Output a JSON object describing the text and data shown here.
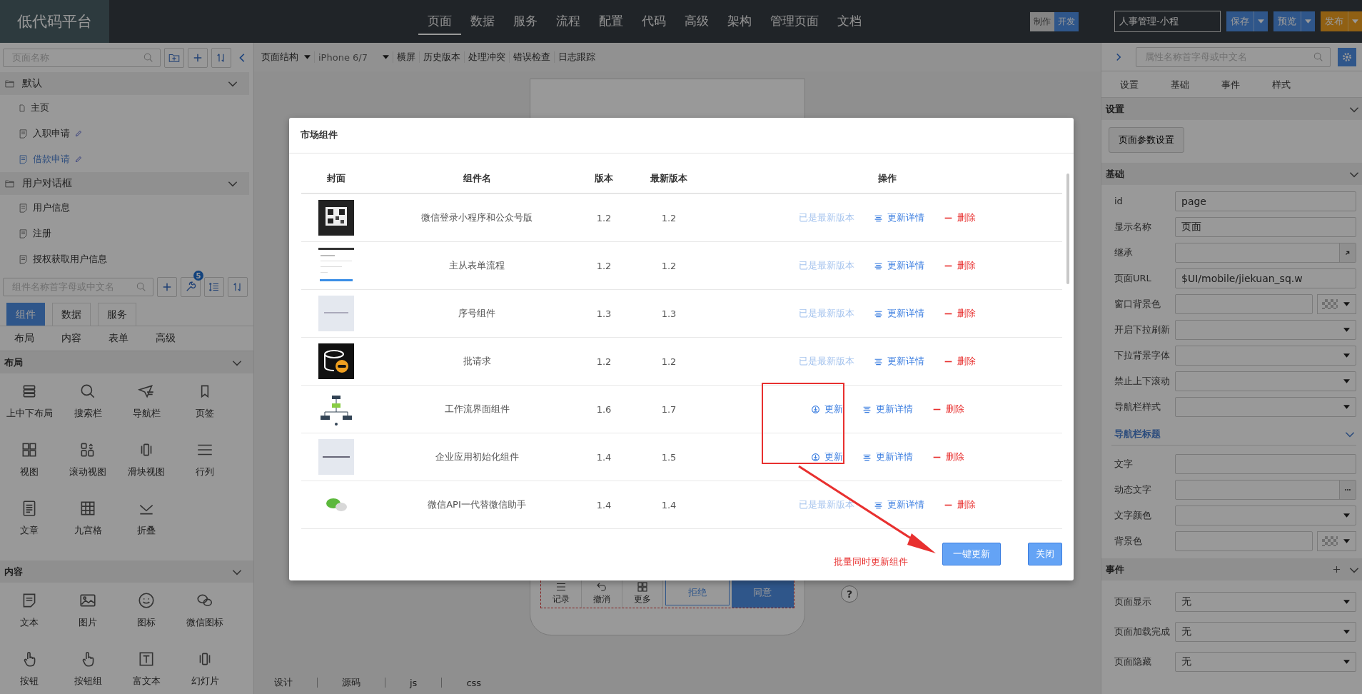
{
  "topbar": {
    "logo": "低代码平台",
    "nav": [
      {
        "label": "页面",
        "selected": true
      },
      {
        "label": "数据",
        "selected": false
      },
      {
        "label": "服务",
        "selected": false
      },
      {
        "label": "流程",
        "selected": false
      },
      {
        "label": "配置",
        "selected": false
      },
      {
        "label": "代码",
        "selected": false
      },
      {
        "label": "高级",
        "selected": false
      },
      {
        "label": "架构",
        "selected": false
      },
      {
        "label": "管理页面",
        "selected": false
      },
      {
        "label": "文档",
        "selected": false
      }
    ],
    "mode_toggle": [
      {
        "label": "制作",
        "selected": false
      },
      {
        "label": "开发",
        "selected": true
      }
    ],
    "project_select": "人事管理-小程",
    "actions": [
      {
        "label": "保存",
        "kind": "primary"
      },
      {
        "label": "预览",
        "kind": "primary"
      },
      {
        "label": "发布",
        "kind": "warning"
      }
    ]
  },
  "left_panel": {
    "page_search": {
      "placeholder": "页面名称"
    },
    "page_tree": [
      {
        "label": "默认",
        "expanded": true,
        "children": [
          {
            "label": "主页",
            "kind": "home",
            "selected": false,
            "editable": false
          },
          {
            "label": "入职申请",
            "kind": "page",
            "selected": false,
            "editable": true
          },
          {
            "label": "借款申请",
            "kind": "page",
            "selected": true,
            "editable": true
          }
        ]
      },
      {
        "label": "用户对话框",
        "expanded": true,
        "children": [
          {
            "label": "用户信息",
            "kind": "page",
            "selected": false,
            "editable": false
          },
          {
            "label": "注册",
            "kind": "page",
            "selected": false,
            "editable": false
          },
          {
            "label": "授权获取用户信息",
            "kind": "page",
            "selected": false,
            "editable": false
          }
        ]
      }
    ],
    "component_search": {
      "placeholder": "组件名称首字母或中文名"
    },
    "update_badge": "5",
    "tabs": [
      {
        "label": "组件",
        "selected": true
      },
      {
        "label": "数据",
        "selected": false
      },
      {
        "label": "服务",
        "selected": false
      }
    ],
    "categories": [
      "布局",
      "内容",
      "表单",
      "高级"
    ],
    "sections": [
      {
        "title": "布局",
        "expanded": true,
        "items": [
          "上中下布局",
          "搜索栏",
          "导航栏",
          "页签",
          "视图",
          "滚动视图",
          "滑块视图",
          "行列",
          "文章",
          "九宫格",
          "折叠"
        ]
      },
      {
        "title": "内容",
        "expanded": true,
        "items": [
          "文本",
          "图片",
          "图标",
          "微信图标",
          "按钮",
          "按钮组",
          "富文本",
          "幻灯片"
        ]
      }
    ]
  },
  "canvas": {
    "toolbar": {
      "structure_menu": "页面结构",
      "device": "iPhone 6/7",
      "links": [
        "横屏",
        "历史版本",
        "处理冲突",
        "错误检查",
        "日志跟踪"
      ]
    },
    "phone_bar": [
      {
        "label": "记录",
        "kind": "tool"
      },
      {
        "label": "撤消",
        "kind": "tool"
      },
      {
        "label": "更多",
        "kind": "tool"
      },
      {
        "label": "拒绝",
        "kind": "reject"
      },
      {
        "label": "同意",
        "kind": "accept"
      }
    ],
    "help": "?",
    "bottom_tabs": [
      "设计",
      "源码",
      "js",
      "css"
    ]
  },
  "right_panel": {
    "search": {
      "placeholder": "属性名称首字母或中文名"
    },
    "tabs": [
      "设置",
      "基础",
      "事件",
      "样式"
    ],
    "sections": [
      {
        "title": "设置",
        "expanded": true,
        "buttons": [
          "页面参数设置"
        ]
      },
      {
        "title": "基础",
        "expanded": true,
        "fields": [
          {
            "label": "id",
            "kind": "text",
            "value": "page"
          },
          {
            "label": "显示名称",
            "kind": "text",
            "value": "页面"
          },
          {
            "label": "继承",
            "kind": "link"
          },
          {
            "label": "页面URL",
            "kind": "text",
            "value": "$UI/mobile/jiekuan_sq.w"
          },
          {
            "label": "窗口背景色",
            "kind": "color"
          },
          {
            "label": "开启下拉刷新",
            "kind": "select"
          },
          {
            "label": "下拉背景字体",
            "kind": "select"
          },
          {
            "label": "禁止上下滚动",
            "kind": "select"
          },
          {
            "label": "导航栏样式",
            "kind": "select"
          },
          {
            "label": "导航栏标题",
            "kind": "subheading"
          },
          {
            "label": "文字",
            "kind": "text"
          },
          {
            "label": "动态文字",
            "kind": "dots"
          },
          {
            "label": "文字颜色",
            "kind": "select"
          },
          {
            "label": "背景色",
            "kind": "color"
          }
        ]
      },
      {
        "title": "事件",
        "expanded": true,
        "fields": [
          {
            "label": "页面显示",
            "kind": "select",
            "value": "无"
          },
          {
            "label": "页面加载完成",
            "kind": "select",
            "value": "无"
          },
          {
            "label": "页面隐藏",
            "kind": "select",
            "value": "无"
          }
        ]
      }
    ]
  },
  "dialog": {
    "title": "市场组件",
    "columns": [
      "封面",
      "组件名",
      "版本",
      "最新版本",
      "操作"
    ],
    "rows": [
      {
        "name": "微信登录小程序和公众号版",
        "version": "1.2",
        "latest": "1.2",
        "kind": "latest",
        "status_text": "已是最新版本",
        "details": "更新详情",
        "delete": "删除"
      },
      {
        "name": "主从表单流程",
        "version": "1.2",
        "latest": "1.2",
        "kind": "latest",
        "status_text": "已是最新版本",
        "details": "更新详情",
        "delete": "删除"
      },
      {
        "name": "序号组件",
        "version": "1.3",
        "latest": "1.3",
        "kind": "latest",
        "status_text": "已是最新版本",
        "details": "更新详情",
        "delete": "删除"
      },
      {
        "name": "批请求",
        "version": "1.2",
        "latest": "1.2",
        "kind": "latest",
        "status_text": "已是最新版本",
        "details": "更新详情",
        "delete": "删除"
      },
      {
        "name": "工作流界面组件",
        "version": "1.6",
        "latest": "1.7",
        "kind": "update",
        "status_text": "更新",
        "details": "更新详情",
        "delete": "删除"
      },
      {
        "name": "企业应用初始化组件",
        "version": "1.4",
        "latest": "1.5",
        "kind": "update",
        "status_text": "更新",
        "details": "更新详情",
        "delete": "删除"
      },
      {
        "name": "微信API一代替微信助手",
        "version": "1.4",
        "latest": "1.4",
        "kind": "latest",
        "status_text": "已是最新版本",
        "details": "更新详情",
        "delete": "删除"
      }
    ],
    "annotation": "批量同时更新组件",
    "buttons": [
      {
        "label": "一键更新",
        "kind": "primary"
      },
      {
        "label": "关闭",
        "kind": "primary"
      }
    ]
  }
}
